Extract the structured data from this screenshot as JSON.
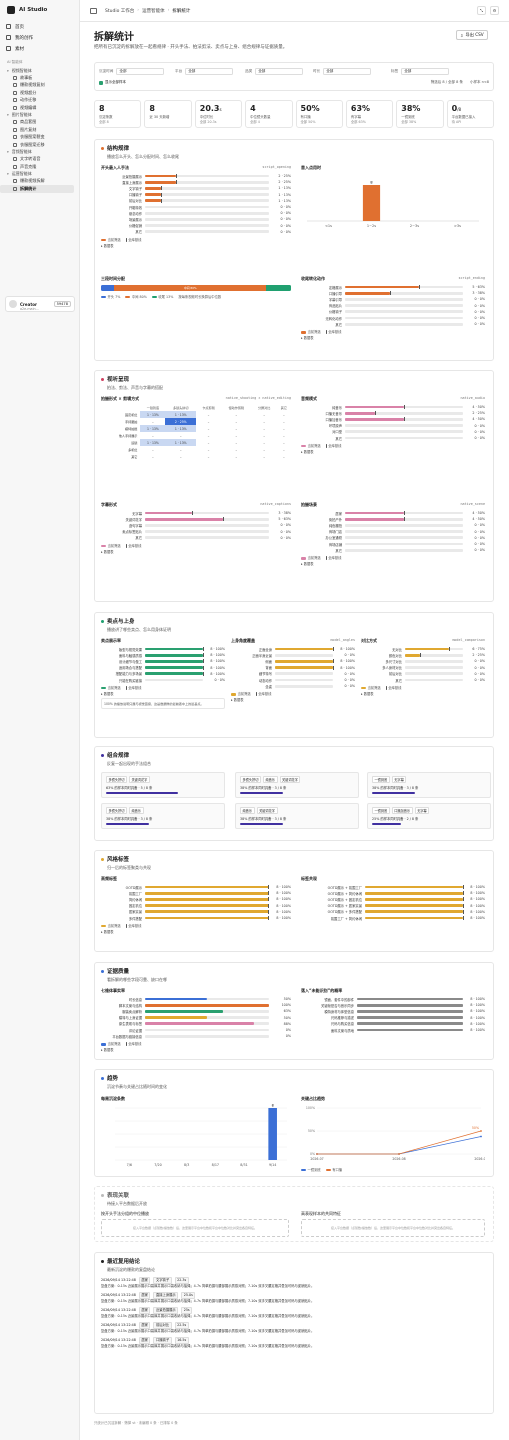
{
  "colors": {
    "orange": "#e07030",
    "blue": "#3b6fd6",
    "green": "#2aa070",
    "pink": "#d982a8",
    "teal": "#20a070",
    "gold": "#e0a830",
    "gray": "#8a8a8a",
    "purple": "#4030a0",
    "track": "#e9e9e9"
  },
  "sidebar": {
    "brand": "AI Studio",
    "top": [
      {
        "label": "首页",
        "icon": "home-icon"
      },
      {
        "label": "我的创作",
        "icon": "file-icon"
      },
      {
        "label": "素材",
        "icon": "image-icon"
      }
    ],
    "section": "AI 智能体",
    "groups": [
      {
        "label": "视频智能体",
        "items": [
          "故事板",
          "爆款视频复刻",
          "视频超分",
          "动作迁移",
          "视频编辑"
        ]
      },
      {
        "label": "图片智能体",
        "items": [
          "商品套图",
          "图片复刻",
          "衣服图案裂变",
          "衣服图案迁移"
        ]
      },
      {
        "label": "音频智能体",
        "items": [
          "文字转语音",
          "声音克隆"
        ]
      },
      {
        "label": "运营智能体",
        "items": [
          "爆款视频拆解",
          "拆解统计"
        ]
      }
    ],
    "user": {
      "name": "Creator",
      "sub": "a2e-main...",
      "credits": "59478"
    }
  },
  "topbar": {
    "crumbs": [
      "Studio 工作台",
      "运营智能体",
      "拆解统计"
    ]
  },
  "page": {
    "title": "拆解统计",
    "desc": "把所有已沉淀的拆解放在一起看规律 · 开头手法、拍法剪法、卖点与上身、组合规律与证据质量。",
    "export": "导出 CSV"
  },
  "filters": {
    "items": [
      {
        "label": "沉淀时间",
        "value": "全部"
      },
      {
        "label": "平台",
        "value": "全部"
      },
      {
        "label": "品类",
        "value": "全部"
      },
      {
        "label": "时长",
        "value": "全部"
      },
      {
        "label": "标签",
        "value": "全部"
      }
    ],
    "check": "显示全部样本",
    "summary": "筛选后 8 / 全部 8 条",
    "warn": "小样本 n<8"
  },
  "stats": [
    {
      "v": "8",
      "u": "",
      "l": "沉淀条数",
      "s": "全部 8"
    },
    {
      "v": "8",
      "u": "",
      "l": "近 30 天新增",
      "s": ""
    },
    {
      "v": "20.3",
      "u": "s",
      "l": "中位时长",
      "s": "全部 20.3s"
    },
    {
      "v": "4",
      "u": "",
      "l": "中位镜头数量",
      "s": "全部 4"
    },
    {
      "v": "50%",
      "u": "",
      "l": "有口播",
      "s": "全部 50%"
    },
    {
      "v": "63%",
      "u": "",
      "l": "有字幕",
      "s": "全部 63%"
    },
    {
      "v": "38%",
      "u": "",
      "l": "一镜到底",
      "s": "全部 38%"
    },
    {
      "v": "0",
      "u": "/8",
      "l": "平台数据已接入",
      "s": "待 API"
    }
  ],
  "legend": {
    "cur": "当前筛选",
    "all": "全库基线",
    "toggle": "数据表"
  },
  "structure": {
    "title": "结构规律",
    "sub": "播放怎么开头、怎么分配时间、怎么收尾",
    "opening": {
      "title": "开头最入人手法",
      "tag": "script_opening",
      "rows": [
        {
          "label": "近景拍摄展示",
          "val": "2 · 25%",
          "pct": 25,
          "base": 25
        },
        {
          "label": "直接上身展示",
          "val": "2 · 25%",
          "pct": 25,
          "base": 25
        },
        {
          "label": "文字钩子",
          "val": "1 · 13%",
          "pct": 13,
          "base": 13
        },
        {
          "label": "口播钩子",
          "val": "1 · 13%",
          "pct": 13,
          "base": 13
        },
        {
          "label": "前后对比",
          "val": "1 · 13%",
          "pct": 13,
          "base": 13
        },
        {
          "label": "开箱特效",
          "val": "0 · 0%",
          "pct": 0,
          "base": 0
        },
        {
          "label": "悬念动作",
          "val": "0 · 0%",
          "pct": 0,
          "base": 0
        },
        {
          "label": "场景展示",
          "val": "0 · 0%",
          "pct": 0,
          "base": 0
        },
        {
          "label": "价格促销",
          "val": "0 · 0%",
          "pct": 0,
          "base": 0
        },
        {
          "label": "其它",
          "val": "0 · 0%",
          "pct": 0,
          "base": 0
        }
      ]
    },
    "firstShot": {
      "title": "首入点用时",
      "cats": [
        "<1s",
        "1~2s",
        "2~3s",
        ">3s"
      ],
      "values": [
        0,
        8,
        0,
        0
      ]
    },
    "timeAlloc": {
      "title": "三段时间分配",
      "open": "7%",
      "mid": "中间 80%",
      "end": "13%",
      "openV": 7,
      "midV": 80,
      "endV": 13,
      "leg": [
        "开头 7%",
        "中间 80%",
        "收尾 13%",
        "按每条视频时长换算后中位数"
      ]
    },
    "ending": {
      "title": "收尾转化动作",
      "tag": "script_ending",
      "rows": [
        {
          "label": "定格展示",
          "val": "5 · 63%",
          "pct": 63,
          "base": 63
        },
        {
          "label": "口播引导",
          "val": "3 · 38%",
          "pct": 38,
          "base": 38
        },
        {
          "label": "字幕引导",
          "val": "0 · 0%",
          "pct": 0,
          "base": 0
        },
        {
          "label": "商品贴片",
          "val": "0 · 0%",
          "pct": 0,
          "base": 0
        },
        {
          "label": "价格钩子",
          "val": "0 · 0%",
          "pct": 0,
          "base": 0
        },
        {
          "label": "无转化动作",
          "val": "0 · 0%",
          "pct": 0,
          "base": 0
        },
        {
          "label": "其它",
          "val": "0 · 0%",
          "pct": 0,
          "base": 0
        }
      ]
    }
  },
  "visual": {
    "title": "视听呈现",
    "sub": "拍法、剪法、声音与字幕的搭配",
    "matrix": {
      "title": "拍摄形式 × 剪辑方式",
      "tag": "native_shooting × native_editing",
      "cols": [
        "一镜到底",
        "多镜头拼切",
        "卡点剪辑",
        "慢动作剪辑",
        "分屏对比",
        "其它"
      ],
      "rows": [
        {
          "label": "固定机位",
          "cells": [
            "1 · 13%",
            "1 · 13%",
            "–",
            "–",
            "–",
            "–"
          ],
          "lv": [
            1,
            1,
            0,
            0,
            0,
            0
          ]
        },
        {
          "label": "手持跟拍",
          "cells": [
            "–",
            "2 · 25%",
            "–",
            "–",
            "–",
            "–"
          ],
          "lv": [
            0,
            2,
            0,
            0,
            0,
            0
          ]
        },
        {
          "label": "模特拍摄",
          "cells": [
            "1 · 13%",
            "1 · 13%",
            "–",
            "–",
            "–",
            "–"
          ],
          "lv": [
            1,
            1,
            0,
            0,
            0,
            0
          ]
        },
        {
          "label": "他人手持展示",
          "cells": [
            "–",
            "–",
            "–",
            "–",
            "–",
            "–"
          ],
          "lv": [
            0,
            0,
            0,
            0,
            0,
            0
          ]
        },
        {
          "label": "运镜",
          "cells": [
            "1 · 13%",
            "1 · 13%",
            "–",
            "–",
            "–",
            "–"
          ],
          "lv": [
            1,
            1,
            0,
            0,
            0,
            0
          ]
        },
        {
          "label": "多机位",
          "cells": [
            "–",
            "–",
            "–",
            "–",
            "–",
            "–"
          ],
          "lv": [
            0,
            0,
            0,
            0,
            0,
            0
          ]
        },
        {
          "label": "其它",
          "cells": [
            "–",
            "–",
            "–",
            "–",
            "–",
            "–"
          ],
          "lv": [
            0,
            0,
            0,
            0,
            0,
            0
          ]
        }
      ]
    },
    "audio": {
      "title": "音频模式",
      "tag": "native_audio",
      "rows": [
        {
          "label": "纯音乐",
          "val": "4 · 50%",
          "pct": 50,
          "base": 50
        },
        {
          "label": "口播无音乐",
          "val": "2 · 25%",
          "pct": 25,
          "base": 25
        },
        {
          "label": "口播加音乐",
          "val": "4 · 50%",
          "pct": 50,
          "base": 50
        },
        {
          "label": "环境原声",
          "val": "0 · 0%",
          "pct": 0,
          "base": 0
        },
        {
          "label": "对口型",
          "val": "0 · 0%",
          "pct": 0,
          "base": 0
        },
        {
          "label": "其它",
          "val": "0 · 0%",
          "pct": 0,
          "base": 0
        }
      ]
    },
    "captions": {
      "title": "字幕形式",
      "tag": "native_captions",
      "rows": [
        {
          "label": "无字幕",
          "val": "3 · 38%",
          "pct": 38,
          "base": 38
        },
        {
          "label": "关键词花字",
          "val": "5 · 63%",
          "pct": 63,
          "base": 63
        },
        {
          "label": "逐句字幕",
          "val": "0 · 0%",
          "pct": 0,
          "base": 0
        },
        {
          "label": "卖点标签贴片",
          "val": "0 · 0%",
          "pct": 0,
          "base": 0
        },
        {
          "label": "其它",
          "val": "0 · 0%",
          "pct": 0,
          "base": 0
        }
      ]
    },
    "scene": {
      "title": "拍摄场景",
      "tag": "native_scene",
      "rows": [
        {
          "label": "居家",
          "val": "4 · 50%",
          "pct": 50,
          "base": 50
        },
        {
          "label": "街拍户外",
          "val": "4 · 50%",
          "pct": 50,
          "base": 50
        },
        {
          "label": "纯色棚拍",
          "val": "0 · 0%",
          "pct": 0,
          "base": 0
        },
        {
          "label": "商场门店",
          "val": "0 · 0%",
          "pct": 0,
          "base": 0
        },
        {
          "label": "办公室通勤",
          "val": "0 · 0%",
          "pct": 0,
          "base": 0
        },
        {
          "label": "商场店铺",
          "val": "0 · 0%",
          "pct": 0,
          "base": 0
        },
        {
          "label": "其它",
          "val": "0 · 0%",
          "pct": 0,
          "base": 0
        }
      ]
    }
  },
  "selling": {
    "title": "卖点与上身",
    "sub": "播放讲了哪些卖点、怎么用身体证明",
    "points": {
      "title": "卖点展示率",
      "rows": [
        {
          "label": "版型与视觉效果",
          "val": "8 · 100%",
          "pct": 100,
          "base": 100
        },
        {
          "label": "面料与触感质感",
          "val": "8 · 100%",
          "pct": 100,
          "base": 100
        },
        {
          "label": "设计细节与做工",
          "val": "8 · 100%",
          "pct": 100,
          "base": 100
        },
        {
          "label": "适用场合与搭配",
          "val": "8 · 100%",
          "pct": 100,
          "base": 100
        },
        {
          "label": "搭配能力与多场景",
          "val": "8 · 100%",
          "pct": 100,
          "base": 100
        },
        {
          "label": "只能在购买链接",
          "val": "0 · 0%",
          "pct": 0,
          "base": 0
        }
      ],
      "note": "100% 的播放说明只展与视觉链接、这是数据样的最前者中上的最基点。"
    },
    "angles": {
      "title": "上身角度覆盖",
      "tag": "model_angles",
      "rows": [
        {
          "label": "正面全身",
          "val": "8 · 100%",
          "pct": 100,
          "base": 100
        },
        {
          "label": "正面半身近景",
          "val": "0 · 0%",
          "pct": 0,
          "base": 0
        },
        {
          "label": "侧面",
          "val": "8 · 100%",
          "pct": 100,
          "base": 100
        },
        {
          "label": "背面",
          "val": "8 · 100%",
          "pct": 100,
          "base": 100
        },
        {
          "label": "细节特写",
          "val": "0 · 0%",
          "pct": 0,
          "base": 0
        },
        {
          "label": "动态动作",
          "val": "0 · 0%",
          "pct": 0,
          "base": 0
        },
        {
          "label": "坐姿",
          "val": "0 · 0%",
          "pct": 0,
          "base": 0
        }
      ]
    },
    "compare": {
      "title": "对比方式",
      "tag": "model_comparison",
      "rows": [
        {
          "label": "无对比",
          "val": "6 · 75%",
          "pct": 75,
          "base": 75
        },
        {
          "label": "颜色对比",
          "val": "2 · 25%",
          "pct": 25,
          "base": 25
        },
        {
          "label": "多尺寸对比",
          "val": "0 · 0%",
          "pct": 0,
          "base": 0
        },
        {
          "label": "多人身材对比",
          "val": "0 · 0%",
          "pct": 0,
          "base": 0
        },
        {
          "label": "前后对比",
          "val": "0 · 0%",
          "pct": 0,
          "base": 0
        },
        {
          "label": "其它",
          "val": "0 · 0%",
          "pct": 0,
          "base": 0
        }
      ]
    }
  },
  "combo": {
    "title": "组合规律",
    "sub": "反复一起出现的手法组合",
    "items": [
      {
        "tags": [
          "多镜头拼切",
          "关键词花字"
        ],
        "pct": "63% 的样本同时具备 · 5 / 8 条",
        "w": 63
      },
      {
        "tags": [
          "多镜头拼切",
          "纯音乐",
          "关键词花字"
        ],
        "pct": "38% 的样本同时具备 · 3 / 8 条",
        "w": 38
      },
      {
        "tags": [
          "一镜到底",
          "无字幕"
        ],
        "pct": "38% 的样本同时具备 · 3 / 8 条",
        "w": 38
      },
      {
        "tags": [
          "多镜头拼切",
          "纯音乐"
        ],
        "pct": "38% 的样本同时具备 · 3 / 8 条",
        "w": 38
      },
      {
        "tags": [
          "纯音乐",
          "关键词花字"
        ],
        "pct": "38% 的样本同时具备 · 3 / 8 条",
        "w": 38
      },
      {
        "tags": [
          "一镜到底",
          "口播加音乐",
          "无字幕"
        ],
        "pct": "25% 的样本同时具备 · 2 / 8 条",
        "w": 25
      }
    ]
  },
  "style": {
    "title": "风格标签",
    "sub": "归一后的标签聚类与共现",
    "high": {
      "title": "高频标签",
      "rows": [
        {
          "label": "OOTD展示",
          "val": "8 · 100%",
          "pct": 100,
          "base": 100
        },
        {
          "label": "氛围工厂",
          "val": "8 · 100%",
          "pct": 100,
          "base": 100
        },
        {
          "label": "简约休闲",
          "val": "8 · 100%",
          "pct": 100,
          "base": 100
        },
        {
          "label": "固定机位",
          "val": "8 · 100%",
          "pct": 100,
          "base": 100
        },
        {
          "label": "居家实景",
          "val": "8 · 100%",
          "pct": 100,
          "base": 100
        },
        {
          "label": "多件搭配",
          "val": "8 · 100%",
          "pct": 100,
          "base": 100
        }
      ]
    },
    "co": {
      "title": "标签共现",
      "rows": [
        {
          "label": "OOTD展示 + 氛围工厂",
          "val": "8 · 100%",
          "pct": 100,
          "base": 100
        },
        {
          "label": "OOTD展示 + 简约休闲",
          "val": "8 · 100%",
          "pct": 100,
          "base": 100
        },
        {
          "label": "OOTD展示 + 固定机位",
          "val": "8 · 100%",
          "pct": 100,
          "base": 100
        },
        {
          "label": "OOTD展示 + 居家实景",
          "val": "8 · 100%",
          "pct": 100,
          "base": 100
        },
        {
          "label": "OOTD展示 + 多件搭配",
          "val": "8 · 100%",
          "pct": 100,
          "base": 100
        },
        {
          "label": "氛围工厂 + 简约休闲",
          "val": "8 · 100%",
          "pct": 100,
          "base": 100
        }
      ]
    }
  },
  "evidence": {
    "title": "证据质量",
    "sub": "看拆解的哪些字段可靠、缺口在哪",
    "fill": {
      "title": "七维体事实率",
      "rows": [
        {
          "label": "时长信息",
          "val": "50%",
          "pct": 50,
          "color": "blue"
        },
        {
          "label": "脚本文案与结构",
          "val": "100%",
          "pct": 100,
          "color": "orange"
        },
        {
          "label": "服装卖点解析",
          "val": "63%",
          "pct": 63,
          "color": "green"
        },
        {
          "label": "模特与上身证据",
          "val": "50%",
          "pct": 50,
          "color": "gold"
        },
        {
          "label": "原生表现与标签",
          "val": "88%",
          "pct": 88,
          "color": "pink"
        },
        {
          "label": "评论证据",
          "val": "0%",
          "pct": 0,
          "color": "teal"
        },
        {
          "label": "平台数据与链接信息",
          "val": "0%",
          "pct": 0,
          "color": "gray"
        }
      ]
    },
    "unknown": {
      "title": "落入“未能识别”的概率",
      "rows": [
        {
          "label": "镜面、套件中的部件",
          "val": "8 · 100%",
          "pct": 100
        },
        {
          "label": "关键帧是否与音乐同步",
          "val": "8 · 100%",
          "pct": 100
        },
        {
          "label": "模特身材与体型信息",
          "val": "8 · 100%",
          "pct": 100
        },
        {
          "label": "尺码推荐与描述",
          "val": "8 · 100%",
          "pct": 100
        },
        {
          "label": "尺码与购买信息",
          "val": "8 · 100%",
          "pct": 100
        },
        {
          "label": "面料文案与质地",
          "val": "8 · 100%",
          "pct": 100
        }
      ]
    }
  },
  "trend": {
    "title": "趋势",
    "sub": "沉淀节奏与关键占比随时间的变化",
    "weekly": {
      "title": "每周沉淀条数",
      "cats": [
        "7/6",
        "7/20",
        "8/3",
        "8/17",
        "8/31",
        "9/14"
      ],
      "values": [
        0,
        0,
        0,
        0,
        0,
        8
      ],
      "yticks": [
        0,
        2,
        4,
        6,
        8
      ]
    },
    "ratio": {
      "title": "关键占比趋势",
      "x": [
        "2026-07",
        "2026-08",
        "2026-09"
      ],
      "yticks": [
        "0%",
        "50%",
        "100%"
      ],
      "series": [
        {
          "name": "一镜到底",
          "values": [
            0,
            0,
            38
          ],
          "color": "#3b6fd6"
        },
        {
          "name": "有口播",
          "values": [
            0,
            0,
            50
          ],
          "color": "#e07030"
        }
      ],
      "label": "50%"
    }
  },
  "perf": {
    "title": "表现关联",
    "sub": "待接入平台数据后开放",
    "left": {
      "title": "按开头手法分组的中位播放",
      "empty": "接入平台数据（点赞数/播放数）后，这里展示平台中位数和平台中位数对比并突出各自特征。"
    },
    "right": {
      "title": "高表现样本的共同特征",
      "empty": "接入平台数据（点赞数/播放数）后，这里展示平台中位数和平台中位数对比并突出各自特征。"
    }
  },
  "recent": {
    "title": "最近复用结论",
    "sub": "最新沉淀的爆款的复盘结论",
    "items": [
      {
        "time": "2026/09/14 13:22:48",
        "tags": [
          "居家",
          "文字钩子",
          "22.3s"
        ],
        "text": "复盘方案：0-15s 近景展示展示口袋裤并展示口袋收纳与抽绳；4-7s 简单拍摄与腰部展示质感对照；7-10s 双手叉腰定格并叠加可码与促销贴片。"
      },
      {
        "time": "2026/09/14 13:22:48",
        "tags": [
          "居家",
          "直接上身展示",
          "25.0s"
        ],
        "text": "复盘方案：0-15s 近景展示展示口袋裤并展示口袋收纳与抽绳；4-7s 简单拍摄与腰部展示质感对照；7-10s 双手叉腰定格并叠加可码与促销贴片。"
      },
      {
        "time": "2026/09/14 13:22:48",
        "tags": [
          "居家",
          "近景拍摄展示",
          "25s"
        ],
        "text": "复盘方案：0-15s 近景展示展示口袋裤并展示口袋收纳与抽绳；4-7s 简单拍摄与腰部展示质感对照；7-10s 双手叉腰定格并叠加可码与促销贴片。"
      },
      {
        "time": "2026/09/14 13:22:48",
        "tags": [
          "居家",
          "前后对比",
          "22.5s"
        ],
        "text": "复盘方案：0-15s 近景展示展示口袋裤并展示口袋收纳与抽绳；4-7s 简单拍摄与腰部展示质感对照；7-10s 双手叉腰定格并叠加可码与促销贴片。"
      },
      {
        "time": "2026/09/14 13:22:48",
        "tags": [
          "居家",
          "口播钩子",
          "16.5s"
        ],
        "text": "复盘方案：0-15s 近景展示展示口袋裤并展示口袋收纳与抽绳；4-7s 简单拍摄与腰部展示质感对照；7-10s 双手叉腰定格并叠加可码与促销贴片。"
      }
    ]
  },
  "footer": "只统计已沉淀拆解 · 筛掉 vt · 未编辑 0 条 · 已排除 0 条"
}
